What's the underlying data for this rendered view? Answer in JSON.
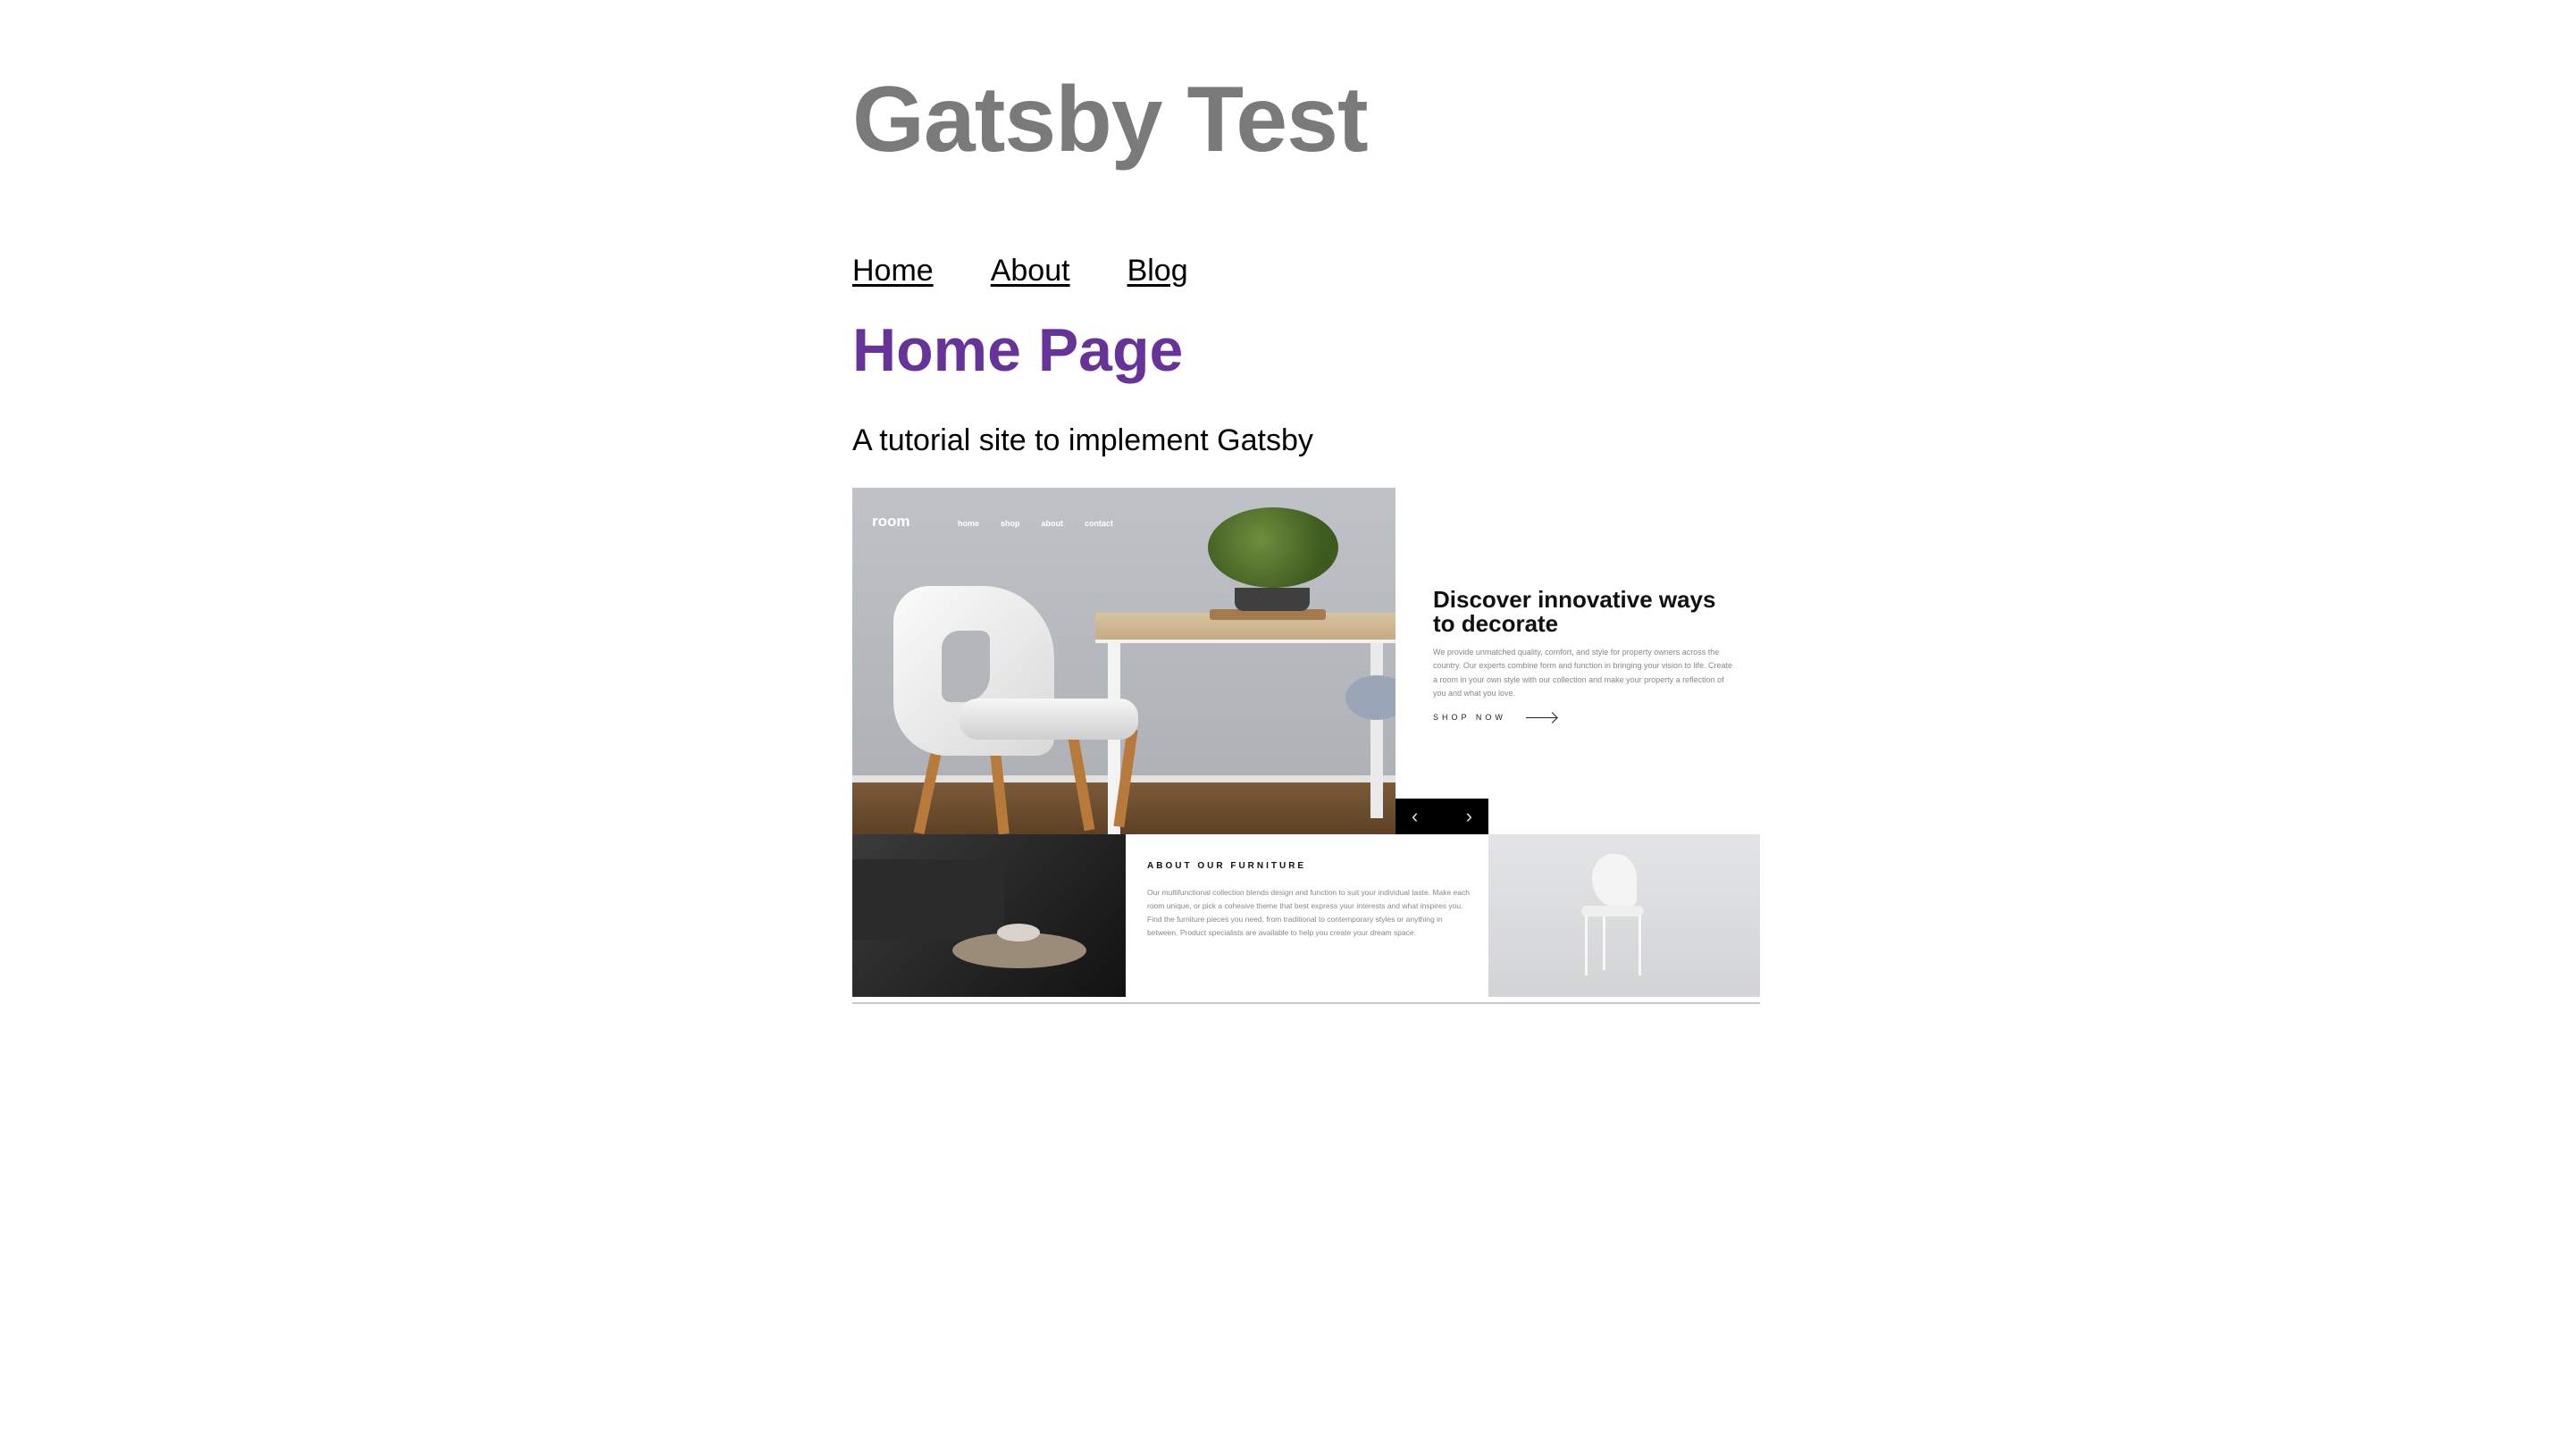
{
  "site": {
    "title": "Gatsby Test"
  },
  "nav": {
    "items": [
      {
        "label": "Home"
      },
      {
        "label": "About"
      },
      {
        "label": "Blog"
      }
    ]
  },
  "page": {
    "heading": "Home Page",
    "tagline": "A tutorial site to implement Gatsby"
  },
  "featured_image": {
    "logo": "room",
    "nav": [
      "home",
      "shop",
      "about",
      "contact"
    ],
    "hero_heading": "Discover innovative ways to decorate",
    "hero_body": "We provide unmatched quality, comfort, and style for property owners across the country. Our experts combine form and function in bringing your vision to life. Create a room in your own style with our collection and make your property a reflection of you and what you love.",
    "shop_label": "SHOP NOW",
    "prev_icon": "chevron-left-icon",
    "next_icon": "chevron-right-icon",
    "about_heading": "ABOUT OUR FURNITURE",
    "about_body": "Our multifunctional collection blends design and function to suit your individual taste. Make each room unique, or pick a cohesive theme that best express your interests and what inspires you. Find the furniture pieces you need, from traditional to contemporary styles or anything in between. Product specialists are available to help you create your dream space."
  },
  "colors": {
    "title": "#7a7a7a",
    "heading": "#663399",
    "text": "#000000"
  }
}
